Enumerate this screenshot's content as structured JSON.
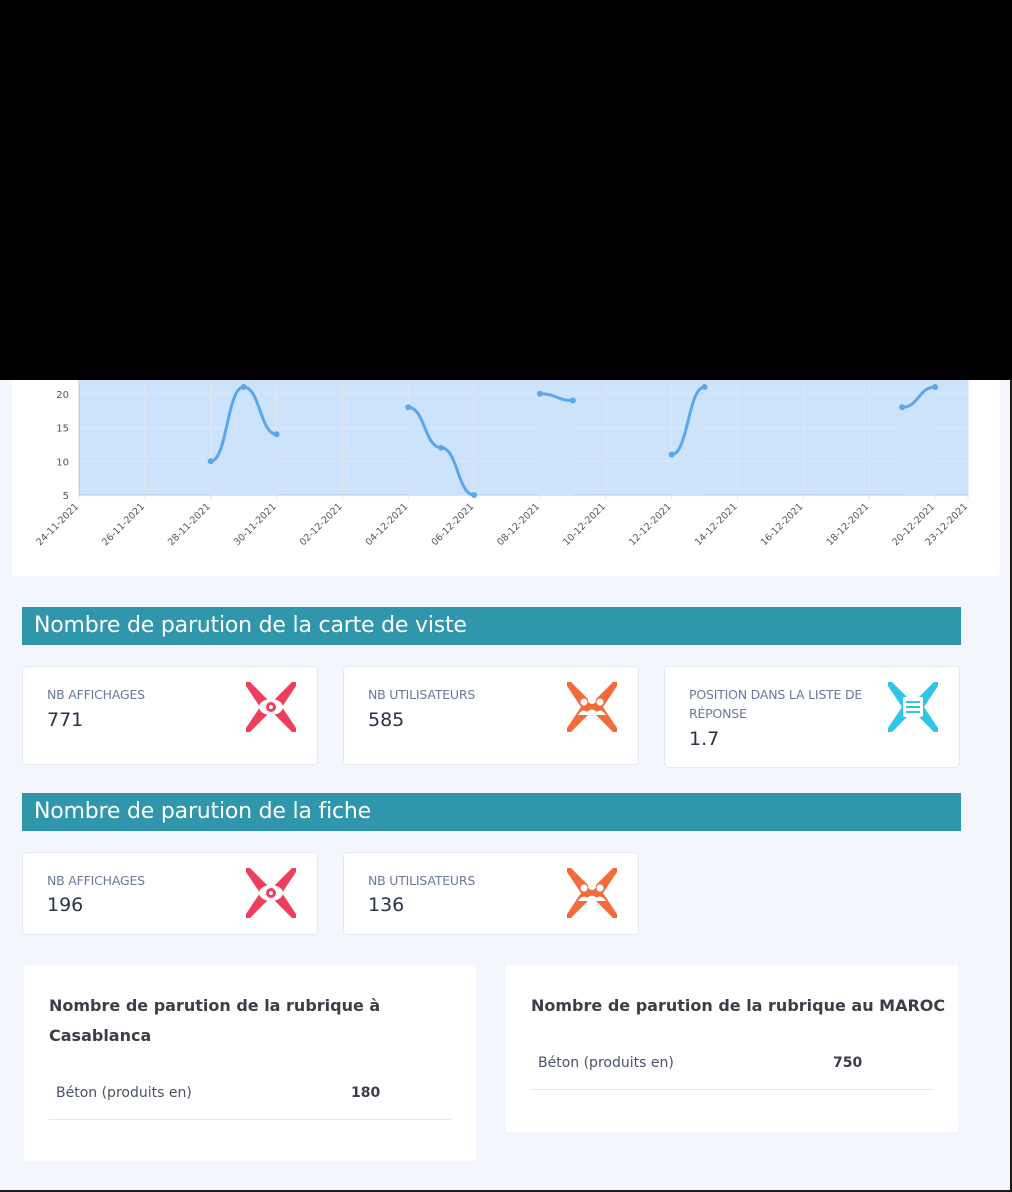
{
  "chart_data": {
    "type": "area",
    "x": [
      "24-11-2021",
      "25-11-2021",
      "26-11-2021",
      "27-11-2021",
      "28-11-2021",
      "29-11-2021",
      "30-11-2021",
      "01-12-2021",
      "02-12-2021",
      "03-12-2021",
      "04-12-2021",
      "05-12-2021",
      "06-12-2021",
      "07-12-2021",
      "08-12-2021",
      "09-12-2021",
      "10-12-2021",
      "11-12-2021",
      "12-12-2021",
      "13-12-2021",
      "14-12-2021",
      "15-12-2021",
      "16-12-2021",
      "17-12-2021",
      "18-12-2021",
      "19-12-2021",
      "20-12-2021",
      "23-12-2021"
    ],
    "x_tick_labels": [
      "24-11-2021",
      "26-11-2021",
      "28-11-2021",
      "30-11-2021",
      "02-12-2021",
      "04-12-2021",
      "06-12-2021",
      "08-12-2021",
      "10-12-2021",
      "12-12-2021",
      "14-12-2021",
      "16-12-2021",
      "18-12-2021",
      "20-12-2021",
      "23-12-2021"
    ],
    "series": [
      {
        "values": [
          null,
          null,
          null,
          null,
          10,
          21,
          14,
          null,
          null,
          null,
          18,
          12,
          5,
          null,
          20,
          19,
          null,
          null,
          11,
          21,
          null,
          null,
          null,
          null,
          null,
          18,
          21,
          null
        ]
      }
    ],
    "ylim": [
      5,
      25
    ],
    "y_ticks": [
      5,
      10,
      15,
      20
    ],
    "grid": true,
    "colors": {
      "line": "#5aa7ee",
      "fill": "#cde3fb",
      "grid": "#e3e6ec"
    }
  },
  "section_visite": {
    "title": "Nombre de parution de la carte de viste",
    "stats": [
      {
        "label": "NB AFFICHAGES",
        "value": "771",
        "icon": "eye-icon",
        "color": "#ef3e5c"
      },
      {
        "label": "NB UTILISATEURS",
        "value": "585",
        "icon": "users-icon",
        "color": "#f36b3a"
      },
      {
        "label": "POSITION DANS LA LISTE DE RÉPONSE",
        "value": "1.7",
        "icon": "list-icon",
        "color": "#2fc6e6"
      }
    ]
  },
  "section_fiche": {
    "title": "Nombre de parution de la fiche",
    "stats": [
      {
        "label": "NB AFFICHAGES",
        "value": "196",
        "icon": "eye-icon",
        "color": "#ef3e5c"
      },
      {
        "label": "NB UTILISATEURS",
        "value": "136",
        "icon": "users-icon",
        "color": "#f36b3a"
      }
    ]
  },
  "rubrique_casablanca": {
    "title": "Nombre de parution de la rubrique à Casablanca",
    "rows": [
      {
        "label": "Béton (produits en)",
        "value": "180"
      }
    ]
  },
  "rubrique_maroc": {
    "title": "Nombre de parution de la rubrique au MAROC",
    "rows": [
      {
        "label": "Béton (produits en)",
        "value": "750"
      }
    ]
  }
}
